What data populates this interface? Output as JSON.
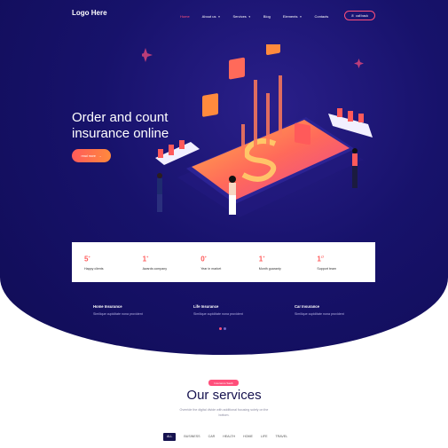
{
  "header": {
    "logo": "Logo Here",
    "nav": [
      {
        "label": "Home",
        "dropdown": false,
        "active": true
      },
      {
        "label": "About us",
        "dropdown": true,
        "active": false
      },
      {
        "label": "Services",
        "dropdown": true,
        "active": false
      },
      {
        "label": "Blog",
        "dropdown": false,
        "active": false
      },
      {
        "label": "Elements",
        "dropdown": true,
        "active": false
      },
      {
        "label": "Contacts",
        "dropdown": false,
        "active": false
      }
    ],
    "call_back": "call back"
  },
  "hero": {
    "title": "Order and count insurance online",
    "button": "read more"
  },
  "stats": [
    {
      "num": "5",
      "suffix": "+",
      "label": "Happy clients"
    },
    {
      "num": "1",
      "suffix": "+",
      "label": "Awards company"
    },
    {
      "num": "0",
      "suffix": "+",
      "label": "Year in market"
    },
    {
      "num": "1",
      "suffix": "+",
      "label": "Month guaranty"
    },
    {
      "num": "1",
      "suffix": "/7",
      "label": "Support team"
    }
  ],
  "features": [
    {
      "title": "Home Insurance",
      "text": "Similique cupiditate nona provident"
    },
    {
      "title": "Life Insurance",
      "text": "Similique cupiditate nona provident"
    },
    {
      "title": "Car Insurance",
      "text": "Similique cupiditate nona provident"
    }
  ],
  "services": {
    "badge": "Insurance SaaS",
    "title": "Our services",
    "desc": "Override the digital divide with additional focusing solely on the bottom.",
    "filters": [
      "ALL",
      "BUSINESS",
      "CAR",
      "HEALTH",
      "HOME",
      "LIFE",
      "TRAVEL"
    ]
  },
  "colors": {
    "accent": "#ff4f7b",
    "hero_bg": "#17126b",
    "gradient_start": "#ff5a5a",
    "gradient_end": "#ff8a3d"
  }
}
